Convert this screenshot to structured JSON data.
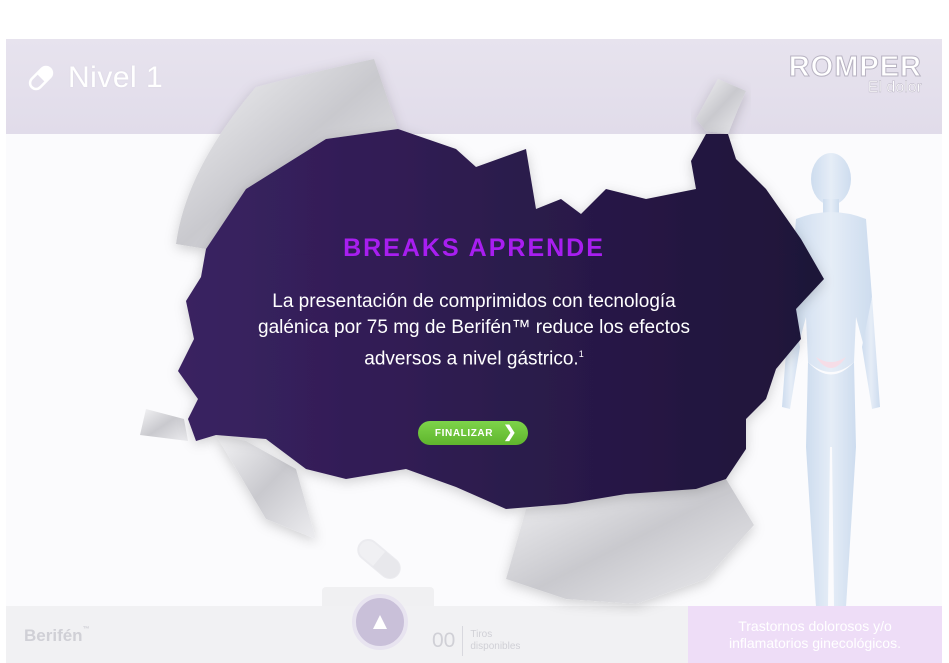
{
  "header": {
    "level_label": "Nivel 1",
    "brand_title": "ROMPER",
    "brand_subtitle": "El dolor"
  },
  "card": {
    "title": "BREAKS APRENDE",
    "body": "La presentación de comprimidos con tecnología galénica por 75 mg de Berifén™ reduce los efectos adversos a nivel gástrico.",
    "footnote_mark": "1",
    "button_label": "FINALIZAR"
  },
  "footer": {
    "brand": "Berifén",
    "brand_mark": "™",
    "counter_value": "00",
    "counter_label": "Tiros disponibles",
    "topic": "Trastornos dolorosos y/o inflamatorios ginecológicos."
  },
  "colors": {
    "card_dark": "#1e1438",
    "card_purple": "#3a2262",
    "title_purple": "#a81ef0",
    "button_green": "#6cc73b",
    "header_band": "#e4e0ec"
  },
  "icons": [
    "pill-icon",
    "chevron-right-icon",
    "aim-arrow-icon",
    "body-figure-icon"
  ]
}
